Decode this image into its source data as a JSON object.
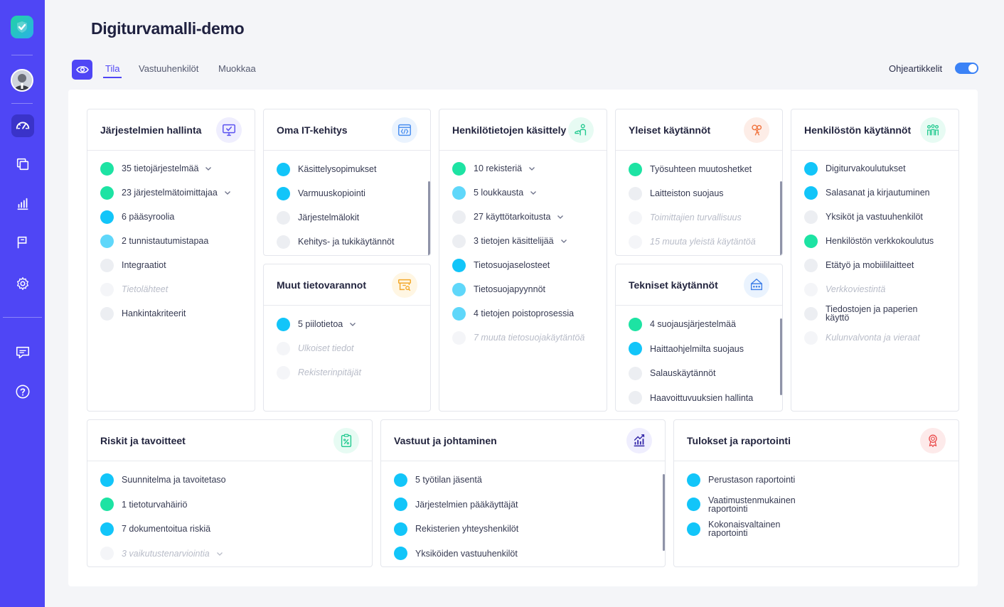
{
  "app": {
    "title": "Digiturvamalli-demo",
    "colors": {
      "accent": "#4f46f5",
      "green": "#1de3a3",
      "blue": "#12c5f9",
      "grey": "#eceef2"
    }
  },
  "sidebar": {
    "items": [
      {
        "icon": "dashboard-icon",
        "active": true
      },
      {
        "icon": "copy-icon"
      },
      {
        "icon": "bar-chart-icon"
      },
      {
        "icon": "flag-icon"
      },
      {
        "icon": "gear-icon"
      },
      {
        "icon": "chat-icon"
      },
      {
        "icon": "help-icon"
      }
    ]
  },
  "tabs": [
    {
      "label": "Tila",
      "active": true
    },
    {
      "label": "Vastuuhenkilöt"
    },
    {
      "label": "Muokkaa"
    }
  ],
  "toggle": {
    "label": "Ohjeartikkelit",
    "on": true
  },
  "cards": {
    "c1": {
      "title": "Järjestelmien hallinta",
      "icon": "monitor-check-icon",
      "items": [
        {
          "label": "35 tietojärjestelmää",
          "status": "green",
          "expand": true
        },
        {
          "label": "23 järjestelmätoimittajaa",
          "status": "green",
          "expand": true
        },
        {
          "label": "6 pääsyroolia",
          "status": "blue"
        },
        {
          "label": "2 tunnistautumistapaa",
          "status": "lblue"
        },
        {
          "label": "Integraatiot",
          "status": "grey"
        },
        {
          "label": "Tietolähteet",
          "status": "faint"
        },
        {
          "label": "Hankintakriteerit",
          "status": "grey"
        }
      ]
    },
    "c2": {
      "title": "Oma IT-kehitys",
      "icon": "code-window-icon",
      "items": [
        {
          "label": "Käsittelysopimukset",
          "status": "blue"
        },
        {
          "label": "Varmuuskopiointi",
          "status": "blue"
        },
        {
          "label": "Järjestelmälokit",
          "status": "grey"
        },
        {
          "label": "Kehitys- ja tukikäytännöt",
          "status": "grey"
        }
      ]
    },
    "c3": {
      "title": "Henkilötietojen käsittely",
      "icon": "person-cloud-icon",
      "items": [
        {
          "label": "10 rekisteriä",
          "status": "green",
          "expand": true
        },
        {
          "label": "5 loukkausta",
          "status": "lblue",
          "expand": true
        },
        {
          "label": "27 käyttötarkoitusta",
          "status": "grey",
          "expand": true
        },
        {
          "label": "3 tietojen käsittelijää",
          "status": "grey",
          "expand": true
        },
        {
          "label": "Tietosuojaselosteet",
          "status": "blue"
        },
        {
          "label": "Tietosuojapyynnöt",
          "status": "lblue"
        },
        {
          "label": "4 tietojen poistoprosessia",
          "status": "lblue"
        },
        {
          "label": "7 muuta tietosuojakäytäntöä",
          "status": "faint"
        }
      ]
    },
    "c4": {
      "title": "Yleiset käytännöt",
      "icon": "keys-icon",
      "items": [
        {
          "label": "Työsuhteen muutoshetket",
          "status": "green"
        },
        {
          "label": "Laitteiston suojaus",
          "status": "grey"
        },
        {
          "label": "Toimittajien turvallisuus",
          "status": "faint"
        },
        {
          "label": "15 muuta yleistä käytäntöä",
          "status": "faint"
        }
      ]
    },
    "c5": {
      "title": "Henkilöstön käytännöt",
      "icon": "people-icon",
      "items": [
        {
          "label": "Digiturvakoulutukset",
          "status": "blue"
        },
        {
          "label": "Salasanat ja kirjautuminen",
          "status": "blue"
        },
        {
          "label": "Yksiköt ja vastuuhenkilöt",
          "status": "grey"
        },
        {
          "label": "Henkilöstön verkkokoulutus",
          "status": "green"
        },
        {
          "label": "Etätyö ja mobiililaitteet",
          "status": "grey"
        },
        {
          "label": "Verkkoviestintä",
          "status": "faint"
        },
        {
          "label": "Tiedostojen ja paperien käyttö",
          "status": "grey"
        },
        {
          "label": "Kulunvalvonta ja vieraat",
          "status": "faint"
        }
      ]
    },
    "c6": {
      "title": "Muut tietovarannot",
      "icon": "archive-search-icon",
      "items": [
        {
          "label": "5 piilotietoa",
          "status": "blue",
          "expand": true
        },
        {
          "label": "Ulkoiset tiedot",
          "status": "faint"
        },
        {
          "label": "Rekisterinpitäjät",
          "status": "faint"
        }
      ]
    },
    "c7": {
      "title": "Tekniset käytännöt",
      "icon": "network-icon",
      "items": [
        {
          "label": "4 suojausjärjestelmää",
          "status": "green"
        },
        {
          "label": "Haittaohjelmilta suojaus",
          "status": "blue"
        },
        {
          "label": "Salauskäytännöt",
          "status": "grey"
        },
        {
          "label": "Haavoittuvuuksien hallinta",
          "status": "grey"
        }
      ]
    },
    "c8": {
      "title": "Riskit ja tavoitteet",
      "icon": "clipboard-percent-icon",
      "items": [
        {
          "label": "Suunnitelma ja tavoitetaso",
          "status": "blue"
        },
        {
          "label": "1 tietoturvahäiriö",
          "status": "green"
        },
        {
          "label": "7 dokumentoitua riskiä",
          "status": "blue"
        },
        {
          "label": "3 vaikutustenarviointia",
          "status": "faint",
          "expand": true
        }
      ]
    },
    "c9": {
      "title": "Vastuut ja johtaminen",
      "icon": "growth-chart-icon",
      "items": [
        {
          "label": "5 työtilan jäsentä",
          "status": "blue"
        },
        {
          "label": "Järjestelmien pääkäyttäjät",
          "status": "blue"
        },
        {
          "label": "Rekisterien yhteyshenkilöt",
          "status": "blue"
        },
        {
          "label": "Yksiköiden vastuuhenkilöt",
          "status": "blue"
        }
      ]
    },
    "c10": {
      "title": "Tulokset ja raportointi",
      "icon": "award-icon",
      "items": [
        {
          "label": "Perustason raportointi",
          "status": "blue"
        },
        {
          "label": "Vaatimustenmukainen raportointi",
          "status": "blue"
        },
        {
          "label": "Kokonaisvaltainen raportointi",
          "status": "blue"
        }
      ]
    }
  }
}
